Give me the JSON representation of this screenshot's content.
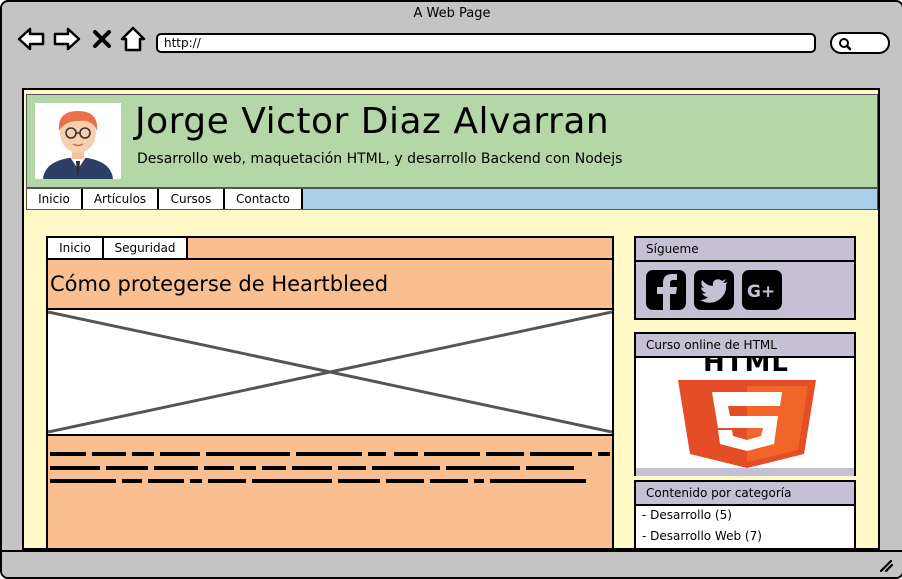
{
  "window": {
    "title": "A Web Page"
  },
  "toolbar": {
    "url": "http://",
    "icons": [
      "back-icon",
      "forward-icon",
      "close-icon",
      "home-icon",
      "search-icon"
    ]
  },
  "header": {
    "title": "Jorge Victor Diaz Alvarran",
    "subtitle": "Desarrollo web, maquetación HTML, y desarrollo Backend con Nodejs"
  },
  "nav": {
    "items": [
      {
        "label": "Inicio"
      },
      {
        "label": "Artículos"
      },
      {
        "label": "Cursos"
      },
      {
        "label": "Contacto"
      }
    ]
  },
  "article": {
    "breadcrumb": [
      {
        "label": "Inicio"
      },
      {
        "label": "Seguridad"
      }
    ],
    "title": "Cómo protegerse de Heartbleed"
  },
  "sidebar": {
    "follow_title": "Sígueme",
    "social": [
      "facebook-icon",
      "twitter-icon",
      "google-plus-icon"
    ],
    "course_title": "Curso online de HTML",
    "html5_logo_text": "HTML",
    "categories_title": "Contenido por categoría",
    "categories": [
      {
        "label": "- Desarrollo (5)"
      },
      {
        "label": "- Desarrollo Web (7)"
      }
    ]
  },
  "colors": {
    "chrome": "#c4c4c4",
    "page_bg": "#fff9c7",
    "header_bg": "#b4d7a8",
    "nav_bg": "#a9cfe9",
    "article_bg": "#f9bf91",
    "sidebar_bg": "#c5c0d4",
    "html5_orange": "#e44d26"
  }
}
